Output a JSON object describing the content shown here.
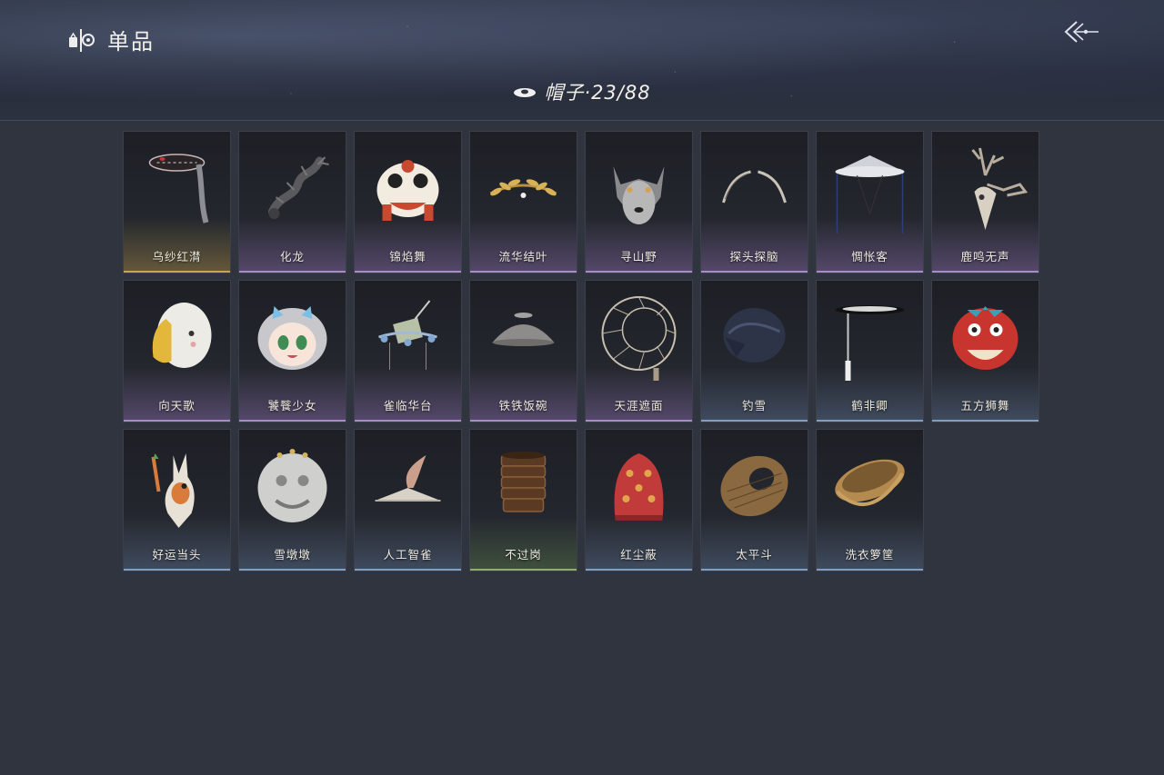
{
  "header": {
    "title": "单品",
    "title_icon": "wardrobe-icon",
    "back_icon": "back-arrow-icon",
    "category_icon": "hat-icon",
    "category_label": "帽子·23/88"
  },
  "colors": {
    "gold": "#c9a54e",
    "purple": "#a98bc9",
    "blue": "#7f9fc4",
    "green": "#8eb06c"
  },
  "items": [
    {
      "name": "乌纱红潸",
      "quality": "gold",
      "icon": "black-gauze-hat-icon"
    },
    {
      "name": "化龙",
      "quality": "purple",
      "icon": "dragon-icon"
    },
    {
      "name": "锦焰舞",
      "quality": "purple",
      "icon": "lion-dance-head-icon"
    },
    {
      "name": "流华结叶",
      "quality": "purple",
      "icon": "golden-leaf-crown-icon"
    },
    {
      "name": "寻山野",
      "quality": "purple",
      "icon": "wolf-head-icon"
    },
    {
      "name": "探头探脑",
      "quality": "purple",
      "icon": "feather-antennae-icon"
    },
    {
      "name": "惆怅客",
      "quality": "purple",
      "icon": "veiled-hat-icon"
    },
    {
      "name": "鹿鸣无声",
      "quality": "purple",
      "icon": "deer-skull-icon"
    },
    {
      "name": "向天歌",
      "quality": "purple",
      "icon": "goose-hood-icon"
    },
    {
      "name": "饕餮少女",
      "quality": "purple",
      "icon": "anime-girl-mask-icon"
    },
    {
      "name": "雀临华台",
      "quality": "purple",
      "icon": "ornate-headdress-icon"
    },
    {
      "name": "铁铁饭碗",
      "quality": "purple",
      "icon": "iron-bowl-icon"
    },
    {
      "name": "天涯遮面",
      "quality": "purple",
      "icon": "bamboo-frame-hat-icon"
    },
    {
      "name": "钓雪",
      "quality": "blue",
      "icon": "cloth-hat-icon"
    },
    {
      "name": "鹤非卿",
      "quality": "blue",
      "icon": "flat-hat-tassel-icon"
    },
    {
      "name": "五方狮舞",
      "quality": "blue",
      "icon": "red-lion-head-icon"
    },
    {
      "name": "好运当头",
      "quality": "blue",
      "icon": "donkey-head-icon"
    },
    {
      "name": "雪墩墩",
      "quality": "blue",
      "icon": "stone-lion-head-icon"
    },
    {
      "name": "人工智雀",
      "quality": "blue",
      "icon": "bird-hat-icon"
    },
    {
      "name": "不过岗",
      "quality": "green",
      "icon": "wine-bowl-stack-icon"
    },
    {
      "name": "红尘蔽",
      "quality": "blue",
      "icon": "red-hood-icon"
    },
    {
      "name": "太平斗",
      "quality": "blue",
      "icon": "woven-basket-hat-icon"
    },
    {
      "name": "洗衣箩筐",
      "quality": "blue",
      "icon": "laundry-basket-icon"
    }
  ]
}
